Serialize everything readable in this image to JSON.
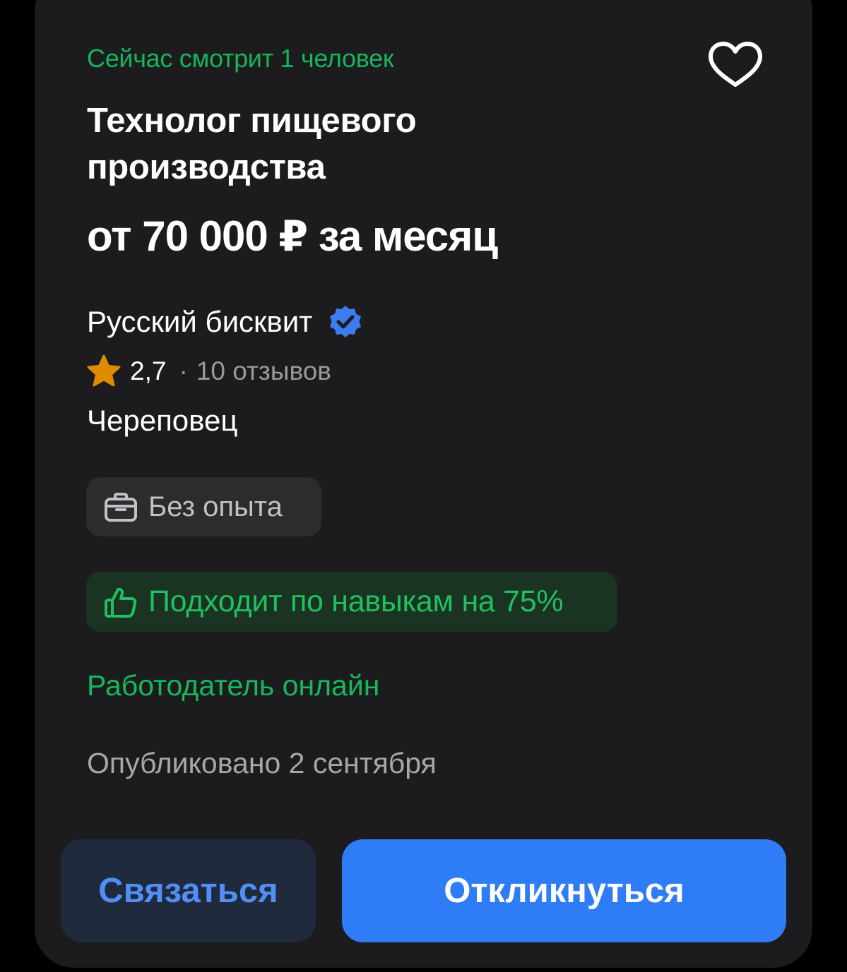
{
  "viewers_text": "Сейчас смотрит 1 человек",
  "title": "Технолог пищевого производства",
  "salary": "от 70 000 ₽ за месяц",
  "company": {
    "name": "Русский бисквит",
    "verified_icon": "verified-badge-icon"
  },
  "rating": {
    "value": "2,7",
    "separator": "·",
    "reviews": "10 отзывов",
    "icon": "star-icon"
  },
  "city": "Череповец",
  "experience_chip": {
    "label": "Без опыта",
    "icon": "briefcase-icon"
  },
  "match_chip": {
    "label": "Подходит по навыкам на 75%",
    "icon": "thumbs-up-icon"
  },
  "employer_status": "Работодатель онлайн",
  "published": "Опубликовано 2 сентября",
  "actions": {
    "contact_label": "Связаться",
    "respond_label": "Откликнуться"
  },
  "favorite_icon": "heart-outline-icon",
  "colors": {
    "accent_green": "#17b45c",
    "primary_blue": "#2f7df6",
    "card_bg": "#1c1c1e",
    "star": "#e08a00",
    "verified": "#3d7cf0"
  }
}
